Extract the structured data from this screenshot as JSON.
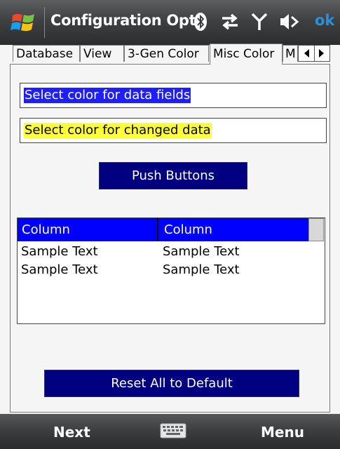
{
  "titlebar": {
    "title": "Configuration Opti",
    "ok_label": "ok",
    "icons": [
      "windows-start-icon",
      "bluetooth-icon",
      "sync-icon",
      "signal-icon",
      "speaker-icon"
    ]
  },
  "tabs": [
    {
      "label": "Database",
      "active": false
    },
    {
      "label": "View",
      "active": false
    },
    {
      "label": "3-Gen Color",
      "active": false
    },
    {
      "label": "Misc Color",
      "active": true
    },
    {
      "label": "M",
      "active": false
    }
  ],
  "fields": {
    "data_fields": {
      "label": "Select color for data fields",
      "color": "#1e1eff"
    },
    "changed_data": {
      "label": "Select color for changed data",
      "color": "#ffff3a"
    }
  },
  "buttons": {
    "push_buttons": "Push Buttons",
    "reset_all": "Reset All to Default"
  },
  "listview": {
    "columns": [
      "Column",
      "Column"
    ],
    "rows": [
      [
        "Sample Text",
        "Sample Text"
      ],
      [
        "Sample Text",
        "Sample Text"
      ]
    ],
    "header_color": "#0000ff"
  },
  "softkeys": {
    "left": "Next",
    "right": "Menu"
  },
  "colors": {
    "button_navy": "#000080",
    "ok_blue": "#2a8fe0"
  }
}
